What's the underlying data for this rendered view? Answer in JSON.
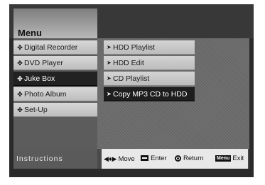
{
  "menu": {
    "title": "Menu"
  },
  "left_menu": {
    "items": [
      {
        "label": "Digital Recorder",
        "bullet": "✤"
      },
      {
        "label": "DVD Player",
        "bullet": "✤"
      },
      {
        "label": "Juke Box",
        "bullet": "✤",
        "selected": true
      },
      {
        "label": "Photo Album",
        "bullet": "✤"
      },
      {
        "label": "Set-Up",
        "bullet": "✤"
      }
    ]
  },
  "sub_menu": {
    "items": [
      {
        "label": "HDD Playlist",
        "arrow": "➤"
      },
      {
        "label": "HDD Edit",
        "arrow": "➤"
      },
      {
        "label": "CD Playlist",
        "arrow": "➤"
      },
      {
        "label": "Copy MP3 CD to HDD",
        "arrow": "➤",
        "selected": true
      }
    ]
  },
  "instructions": {
    "label": "Instructions",
    "move_icon": "◀♦▶",
    "move": "Move",
    "enter": "Enter",
    "return": "Return",
    "menu_key": "Menu",
    "exit": "Exit"
  }
}
